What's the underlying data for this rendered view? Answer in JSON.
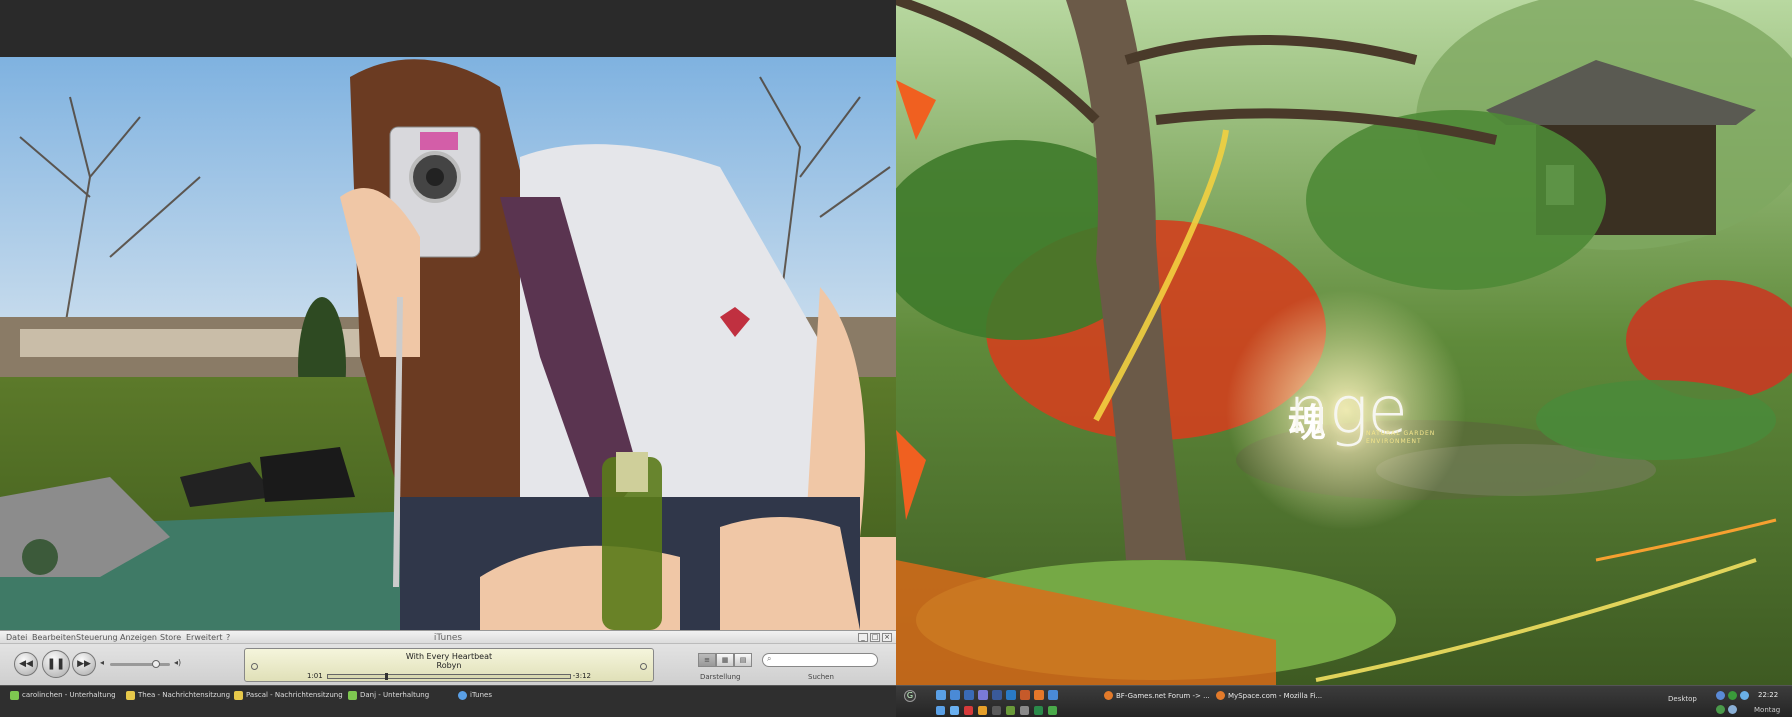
{
  "itunes": {
    "title": "iTunes",
    "menu": [
      "Datei",
      "Bearbeiten",
      "Steuerung",
      "Anzeigen",
      "Store",
      "Erweitert",
      "?"
    ],
    "window_buttons": [
      "_",
      "□",
      "×"
    ],
    "now_playing": {
      "song": "With Every Heartbeat",
      "artist": "Robyn",
      "elapsed": "1:01",
      "remaining": "-3:12",
      "progress": 0.24
    },
    "volume": 0.8,
    "view_label": "Darstellung",
    "search_label": "Suchen",
    "search_placeholder": ""
  },
  "taskbar_left": {
    "items": [
      {
        "label": "carolinchen - Unterhaltung",
        "color": "#7ec850"
      },
      {
        "label": "Thea - Nachrichtensitzung",
        "color": "#e6c84a"
      },
      {
        "label": "Pascal - Nachrichtensitzung",
        "color": "#e6c84a"
      },
      {
        "label": "Danj - Unterhaltung",
        "color": "#7ec850"
      },
      {
        "label": "iTunes",
        "color": "#5aa0e6"
      }
    ]
  },
  "wallpaper_right": {
    "logo_text": "nge",
    "logo_kanji": "魂",
    "subtitle_line1": "NATURAL GARDEN",
    "subtitle_line2": "ENVIRONMENT"
  },
  "taskbar_right": {
    "start_icon": "start-orb-icon",
    "tasks": [
      {
        "label": "BF-Games.net Forum -> ..."
      },
      {
        "label": "MySpace.com - Mozilla Fi..."
      }
    ],
    "desktop_label": "Desktop",
    "clock": "22:22",
    "day": "Montag"
  }
}
